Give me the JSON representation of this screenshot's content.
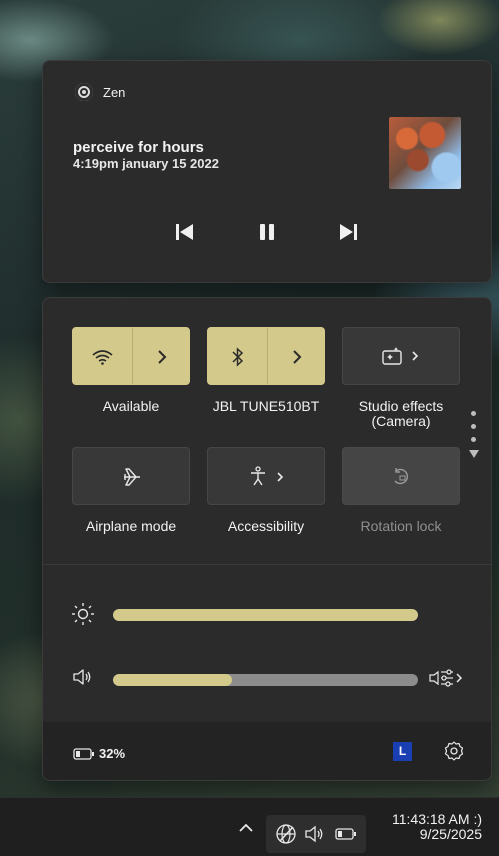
{
  "media": {
    "app_name": "Zen",
    "title": "perceive for hours",
    "subtitle": "4:19pm january 15 2022",
    "controls": {
      "previous": "previous-icon",
      "pause": "pause-icon",
      "next": "next-icon"
    }
  },
  "quick_settings": {
    "tiles": [
      {
        "label": "Available",
        "icon": "wifi-icon",
        "state": "on"
      },
      {
        "label": "JBL TUNE510BT",
        "icon": "bluetooth-icon",
        "state": "on"
      },
      {
        "label": "Studio effects (Camera)",
        "icon": "studio-effects-icon",
        "state": "off"
      },
      {
        "label": "Airplane mode",
        "icon": "airplane-icon",
        "state": "off"
      },
      {
        "label": "Accessibility",
        "icon": "accessibility-icon",
        "state": "off"
      },
      {
        "label": "Rotation lock",
        "icon": "rotation-lock-icon",
        "state": "disabled"
      }
    ],
    "brightness_level": 1.0,
    "volume_level": 0.39,
    "battery": {
      "percent": "32%"
    },
    "badge_letter": "L"
  },
  "taskbar": {
    "time": "11:43:18 AM :)",
    "date": "9/25/2025"
  },
  "colors": {
    "accent": "#d3c98b",
    "panel": "#2b2b2b",
    "badge": "#1a3fb3"
  }
}
